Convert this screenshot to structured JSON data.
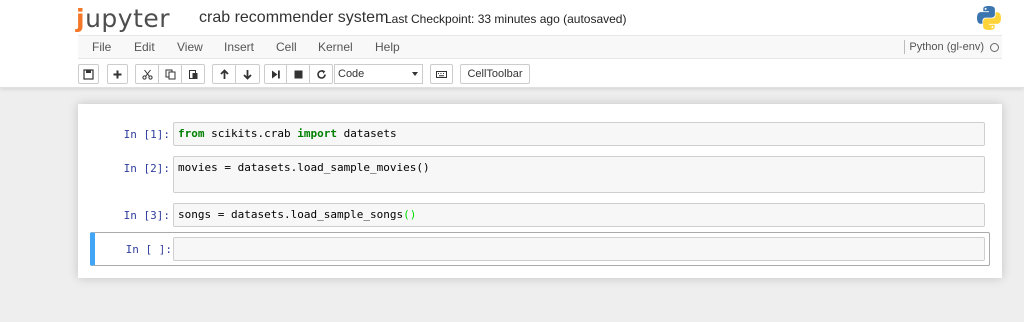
{
  "app": {
    "logo_text": "jupyter",
    "notebook_name": "crab recommender system",
    "checkpoint_text": "Last Checkpoint: 33 minutes ago (autosaved)"
  },
  "menubar": {
    "items": [
      "File",
      "Edit",
      "View",
      "Insert",
      "Cell",
      "Kernel",
      "Help"
    ],
    "kernel_name": "Python (gl-env)"
  },
  "toolbar": {
    "cell_type_selected": "Code",
    "celltoolbar_label": "CellToolbar",
    "icons": [
      "save-icon",
      "plus-icon",
      "cut-icon",
      "copy-icon",
      "paste-icon",
      "arrow-up-icon",
      "arrow-down-icon",
      "step-forward-icon",
      "stop-icon",
      "refresh-icon",
      "keyboard-icon"
    ]
  },
  "cells": [
    {
      "prompt": "In [1]:",
      "code_parts": [
        {
          "t": "from",
          "c": "kw"
        },
        {
          "t": " scikits.crab ",
          "c": ""
        },
        {
          "t": "import",
          "c": "kw"
        },
        {
          "t": " datasets",
          "c": ""
        }
      ]
    },
    {
      "prompt": "In [2]:",
      "code_parts": [
        {
          "t": "movies = datasets.load_sample_movies()",
          "c": ""
        }
      ]
    },
    {
      "prompt": "In [3]:",
      "code_parts": [
        {
          "t": "songs = datasets.load_sample_songs",
          "c": ""
        },
        {
          "t": "()",
          "c": "paren-hl"
        }
      ]
    },
    {
      "prompt": "In [ ]:",
      "code_parts": []
    }
  ],
  "colors": {
    "accent_orange": "#f37726",
    "selected_border": "#42a5f5",
    "prompt_blue": "#303f9f",
    "keyword_green": "#008000"
  }
}
